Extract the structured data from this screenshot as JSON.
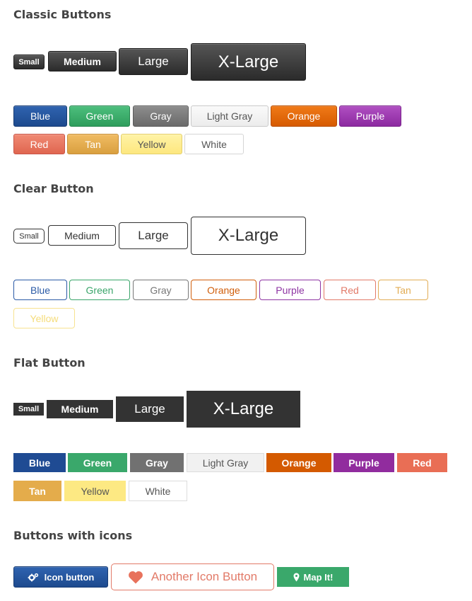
{
  "sections": {
    "classic": "Classic Buttons",
    "clear": "Clear Button",
    "flat": "Flat Button",
    "icons": "Buttons with icons"
  },
  "classic": {
    "sizes": {
      "small": "Small",
      "medium": "Medium",
      "large": "Large",
      "xlarge": "X-Large"
    },
    "colors": {
      "blue": "Blue",
      "green": "Green",
      "gray": "Gray",
      "light_gray": "Light Gray",
      "orange": "Orange",
      "purple": "Purple",
      "red": "Red",
      "tan": "Tan",
      "yellow": "Yellow",
      "white": "White"
    }
  },
  "clear": {
    "sizes": {
      "small": "Small",
      "medium": "Medium",
      "large": "Large",
      "xlarge": "X-Large"
    },
    "colors": {
      "blue": "Blue",
      "green": "Green",
      "gray": "Gray",
      "orange": "Orange",
      "purple": "Purple",
      "red": "Red",
      "tan": "Tan",
      "yellow": "Yellow"
    }
  },
  "flat": {
    "sizes": {
      "small": "Small",
      "medium": "Medium",
      "large": "Large",
      "xlarge": "X-Large"
    },
    "colors": {
      "blue": "Blue",
      "green": "Green",
      "gray": "Gray",
      "light_gray": "Light Gray",
      "orange": "Orange",
      "purple": "Purple",
      "red": "Red",
      "tan": "Tan",
      "yellow": "Yellow",
      "white": "White"
    }
  },
  "icon_buttons": {
    "icon_button": {
      "label": "Icon button",
      "icon": "cogs-icon"
    },
    "another_icon_button": {
      "label": "Another Icon Button",
      "icon": "heart-icon"
    },
    "map_button": {
      "label": "Map It!",
      "icon": "map-marker-icon"
    }
  },
  "palette": {
    "dark": "#333333",
    "blue": "#1f4b93",
    "green": "#3aa86b",
    "gray": "#717171",
    "light_gray": "#f1f1f1",
    "orange": "#d45a00",
    "purple": "#912c9e",
    "red": "#e96e55",
    "tan": "#e4ac4b",
    "yellow": "#fde983",
    "white": "#ffffff"
  }
}
